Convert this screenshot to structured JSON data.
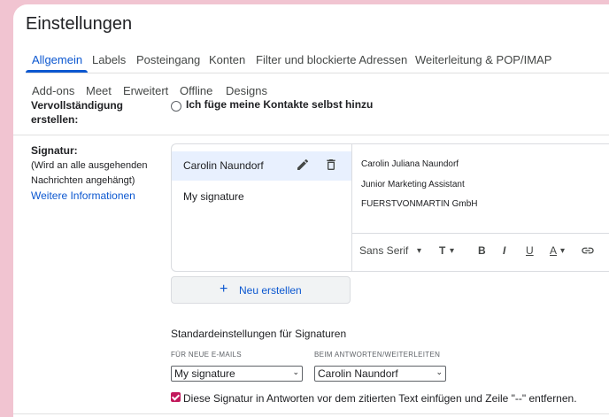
{
  "page": {
    "title": "Einstellungen"
  },
  "tabs": [
    "Allgemein",
    "Labels",
    "Posteingang",
    "Konten",
    "Filter und blockierte Adressen",
    "Weiterleitung & POP/IMAP"
  ],
  "tabs2": [
    "Add-ons",
    "Meet",
    "Erweitert",
    "Offline",
    "Designs"
  ],
  "autocomplete": {
    "label_line1": "Vervollständigung",
    "label_line2": "erstellen:",
    "radio_label": "Ich füge meine Kontakte selbst hinzu"
  },
  "signature": {
    "label": "Signatur:",
    "hint_line1": "(Wird an alle ausgehenden",
    "hint_line2": "Nachrichten angehängt)",
    "more_info": "Weitere Informationen",
    "items": [
      "Carolin Naundorf",
      "My signature"
    ],
    "editor_lines": [
      "Carolin Juliana Naundorf",
      "Junior Marketing Assistant",
      "FUERSTVONMARTIN GmbH"
    ],
    "toolbar": {
      "font": "Sans Serif",
      "font_chevron": "▾",
      "size": "T",
      "bold": "B",
      "italic": "I",
      "underline": "U",
      "color": "A"
    },
    "new_button": "Neu erstellen",
    "new_plus": "+"
  },
  "defaults": {
    "heading": "Standardeinstellungen für Signaturen",
    "new_mail_label": "FÜR NEUE E-MAILS",
    "new_mail_value": "My signature",
    "reply_label": "BEIM ANTWORTEN/WEITERLEITEN",
    "reply_value": "Carolin Naundorf",
    "select_chevron": "⌄",
    "checkbox_text": "Diese Signatur in Antworten vor dem zitierten Text einfügen und Zeile \"--\" entfernen.",
    "checkbox_checked": true
  },
  "colors": {
    "accent": "#0b57d0",
    "page_bg": "#f1c4d1",
    "checkbox": "#c2185b"
  }
}
